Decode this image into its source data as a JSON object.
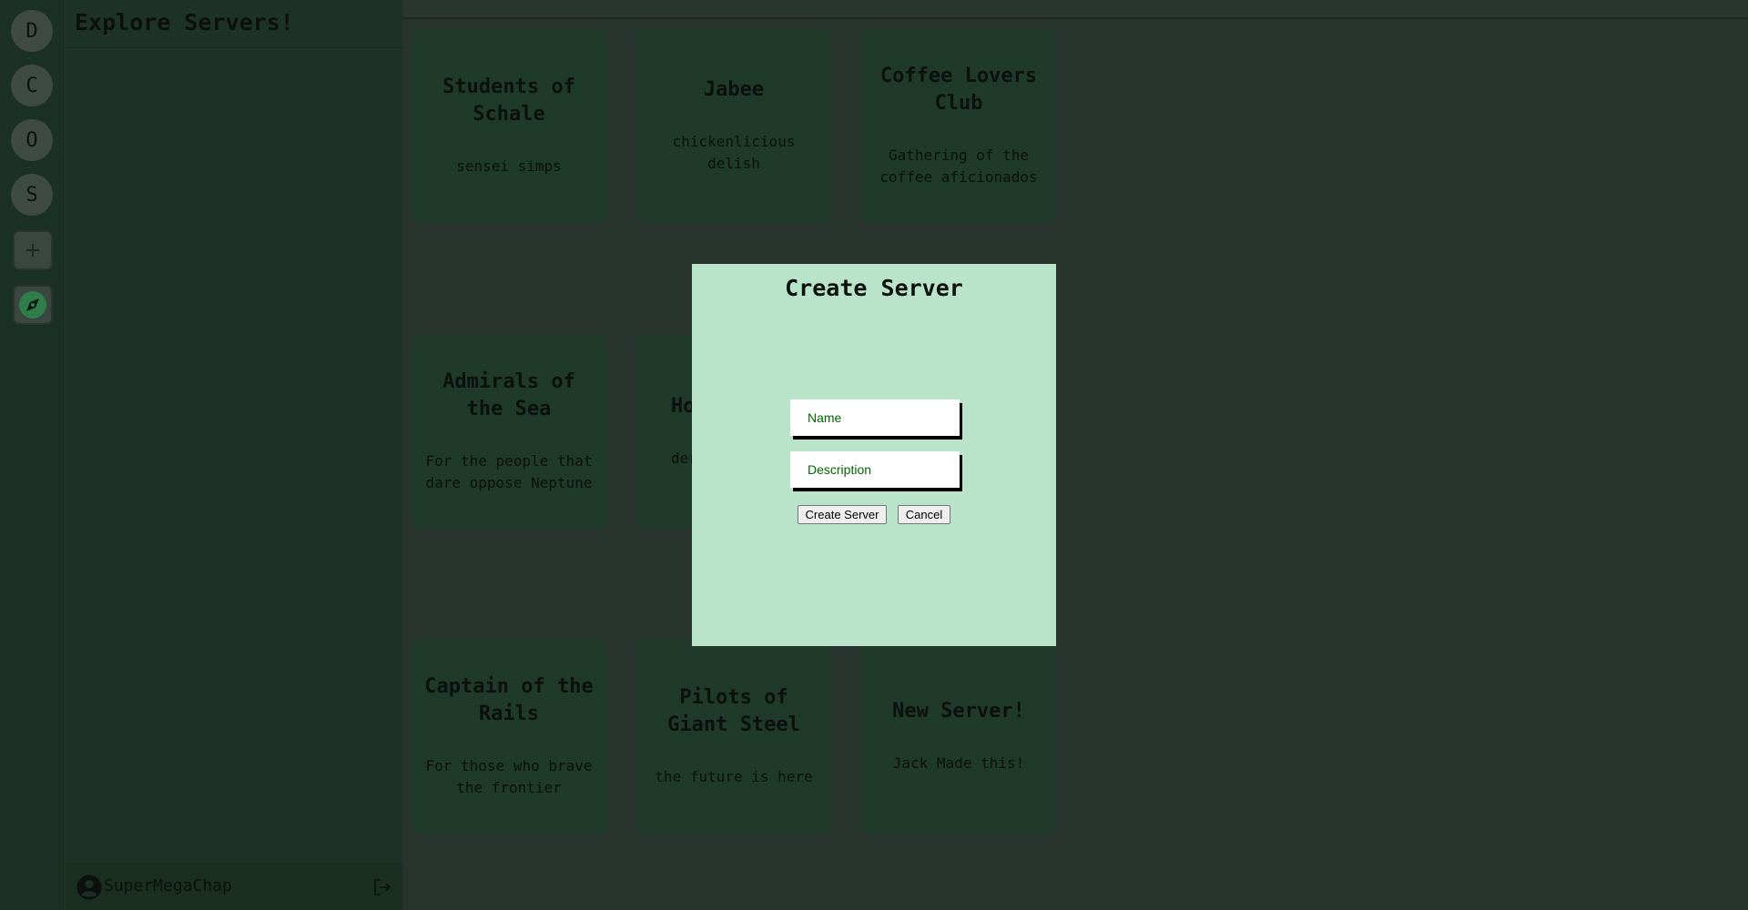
{
  "rail": {
    "servers": [
      {
        "letter": "D"
      },
      {
        "letter": "C"
      },
      {
        "letter": "O"
      },
      {
        "letter": "S"
      }
    ],
    "add_icon": "plus-icon",
    "explore_icon": "compass-icon"
  },
  "sidebar": {
    "title": "Explore Servers!",
    "username": "SuperMegaChap",
    "avatar_icon": "user-circle-icon",
    "logout_icon": "logout-icon"
  },
  "cards": [
    {
      "title": "Students of Schale",
      "description": "sensei simps"
    },
    {
      "title": "Jabee",
      "description": "chickenlicious delish"
    },
    {
      "title": "Coffee Lovers Club",
      "description": "Gathering of the coffee aficionados"
    },
    {
      "title": "Admirals of the Sea",
      "description": "For the people that dare oppose Neptune"
    },
    {
      "title": "Ho",
      "description": "der"
    },
    {
      "title": "Captain of the Rails",
      "description": "For those who brave the frontier"
    },
    {
      "title": "Pilots of Giant Steel",
      "description": "the future is here"
    },
    {
      "title": "New Server!",
      "description": "Jack Made this!"
    }
  ],
  "modal": {
    "title": "Create Server",
    "name_placeholder": "Name",
    "description_placeholder": "Description",
    "create_label": "Create Server",
    "cancel_label": "Cancel"
  },
  "colors": {
    "rail_bg": "#1b3125",
    "sidebar_bg": "#1e3327",
    "main_bg": "#28332d",
    "card_bg": "#1f3a2b",
    "modal_bg": "#b9e4c9",
    "placeholder_text": "#006600"
  }
}
